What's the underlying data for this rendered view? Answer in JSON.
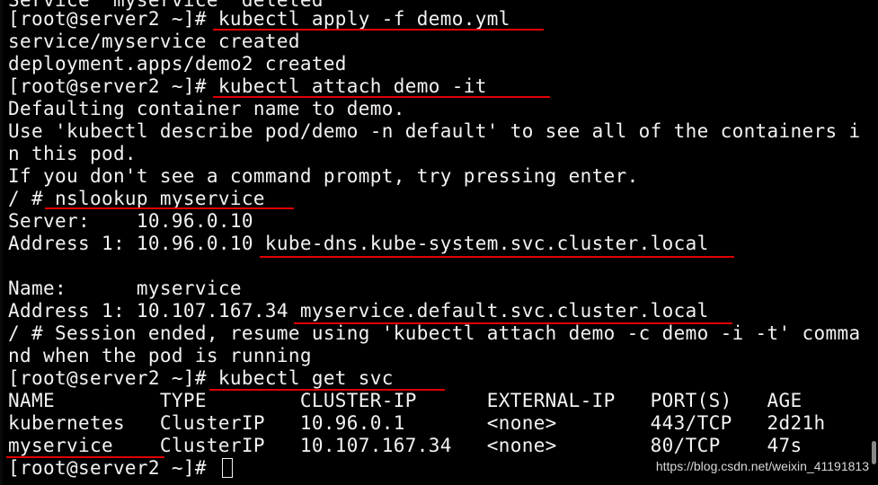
{
  "terminal": {
    "lines": [
      "Service \"myservice\" deleted",
      "[root@server2 ~]# kubectl apply -f demo.yml",
      "service/myservice created",
      "deployment.apps/demo2 created",
      "[root@server2 ~]# kubectl attach demo -it",
      "Defaulting container name to demo.",
      "Use 'kubectl describe pod/demo -n default' to see all of the containers i",
      "n this pod.",
      "If you don't see a command prompt, try pressing enter.",
      "/ # nslookup myservice",
      "Server:    10.96.0.10",
      "Address 1: 10.96.0.10 kube-dns.kube-system.svc.cluster.local",
      "",
      "Name:      myservice",
      "Address 1: 10.107.167.34 myservice.default.svc.cluster.local",
      "/ # Session ended, resume using 'kubectl attach demo -c demo -i -t' comma",
      "nd when the pod is running",
      "[root@server2 ~]# kubectl get svc",
      "NAME         TYPE        CLUSTER-IP      EXTERNAL-IP   PORT(S)   AGE",
      "kubernetes   ClusterIP   10.96.0.1       <none>        443/TCP   2d21h",
      "myservice    ClusterIP   10.107.167.34   <none>        80/TCP    47s",
      "[root@server2 ~]# "
    ]
  },
  "watermark": "https://blog.csdn.net/weixin_41191813",
  "colors": {
    "background": "#000000",
    "text": "#f2f2f2",
    "underline": "#e00000"
  }
}
